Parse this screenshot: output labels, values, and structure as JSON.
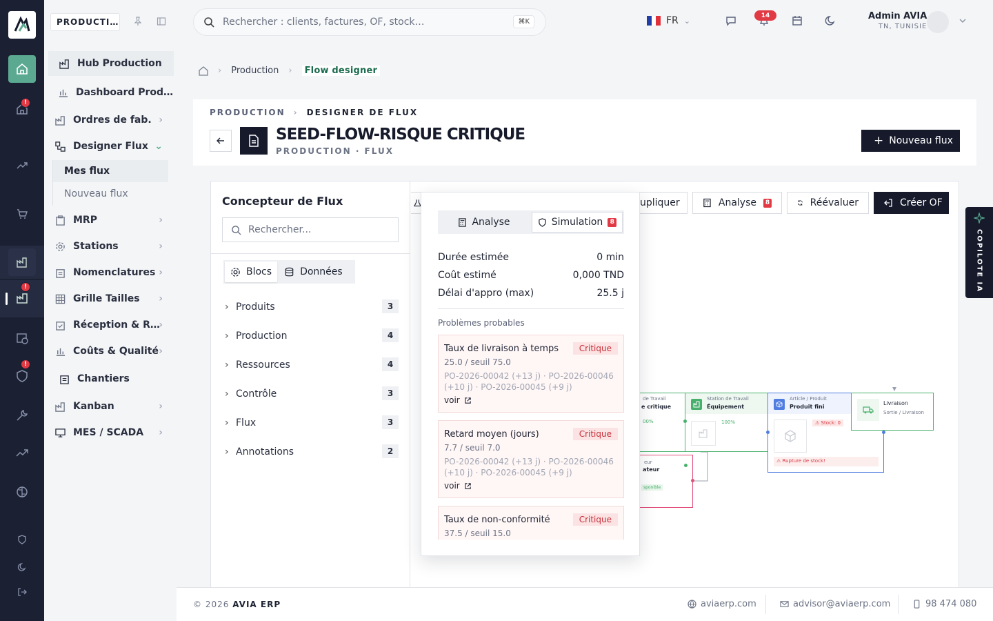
{
  "rail": {
    "badges": [
      "!",
      "!",
      "!"
    ]
  },
  "sidebar": {
    "module": "PRODUCTI…",
    "items": [
      {
        "label": "Hub Production"
      },
      {
        "label": "Dashboard Prod…"
      },
      {
        "label": "Ordres de fab."
      },
      {
        "label": "Designer Flux"
      },
      {
        "label": "MRP"
      },
      {
        "label": "Stations"
      },
      {
        "label": "Nomenclatures"
      },
      {
        "label": "Grille Tailles"
      },
      {
        "label": "Réception & R…"
      },
      {
        "label": "Coûts & Qualité"
      },
      {
        "label": "Chantiers"
      },
      {
        "label": "Kanban"
      },
      {
        "label": "MES / SCADA"
      }
    ],
    "sub": {
      "mes_flux": "Mes flux",
      "nouveau_flux": "Nouveau flux"
    }
  },
  "topbar": {
    "search_placeholder": "Rechercher : clients, factures, OF, stock…",
    "shortcut": "⌘K",
    "lang": "FR",
    "notif_count": "14",
    "user_name": "Admin AVIA",
    "user_country": "TN, TUNISIE"
  },
  "breadcrumb": {
    "production": "Production",
    "current": "Flow designer"
  },
  "header": {
    "eyebrow_section": "PRODUCTION",
    "eyebrow_page": "DESIGNER DE FLUX",
    "title": "SEED-FLOW-RISQUE CRITIQUE",
    "subtitle": "PRODUCTION · FLUX",
    "new_flow": "Nouveau flux"
  },
  "designer": {
    "panel_title": "Concepteur de Flux",
    "search_placeholder": "Rechercher...",
    "tab_blocs": "Blocs",
    "tab_donnees": "Données",
    "categories": [
      {
        "label": "Produits",
        "count": "3"
      },
      {
        "label": "Production",
        "count": "4"
      },
      {
        "label": "Ressources",
        "count": "4"
      },
      {
        "label": "Contrôle",
        "count": "3"
      },
      {
        "label": "Flux",
        "count": "3"
      },
      {
        "label": "Annotations",
        "count": "2"
      }
    ],
    "toolbar": {
      "dupliquer": "upliquer",
      "analyse": "Analyse",
      "analyse_count": "8",
      "reevaluer": "Réévaluer",
      "creer_of": "Créer OF"
    }
  },
  "nodes": {
    "n1_head": "de Travail",
    "n1_title": "e critique",
    "n1_pct": "00%",
    "n2_head": "Station de Travail",
    "n2_title": "Équipement",
    "n2_pct": "100%",
    "n3_head": "Article / Produit",
    "n3_title": "Produit fini",
    "n3_stock": "Stock: 0",
    "n3_alert": "Rupture de stock!",
    "n4_title": "Livraison",
    "n4_sub": "Sortie / Livraison",
    "n5_head": "eur",
    "n5_title": "ateur",
    "n5_tag": "sponible"
  },
  "copilot": "COPILOTE IA",
  "popup": {
    "tab_analyse": "Analyse",
    "tab_simulation": "Simulation",
    "sim_count": "8",
    "rows": [
      {
        "k": "Durée estimée",
        "v": "0 min"
      },
      {
        "k": "Coût estimé",
        "v": "0,000 TND"
      },
      {
        "k": "Délai d'appro (max)",
        "v": "25.5 j"
      }
    ],
    "problems_label": "Problèmes probables",
    "problems": [
      {
        "title": "Taux de livraison à temps",
        "level": "Critique",
        "metric": "25.0 / seuil 75.0",
        "refs": "PO-2026-00042 (+13 j) · PO-2026-00046 (+10 j) · PO-2026-00045 (+9 j)",
        "link": "voir"
      },
      {
        "title": "Retard moyen (jours)",
        "level": "Critique",
        "metric": "7.7 / seuil 7.0",
        "refs": "PO-2026-00042 (+13 j) · PO-2026-00046 (+10 j) · PO-2026-00045 (+9 j)",
        "link": "voir"
      },
      {
        "title": "Taux de non-conformité",
        "level": "Critique",
        "metric": "37.5 / seuil 15.0"
      }
    ]
  },
  "footer": {
    "copyright": "© 2026",
    "brand": "AVIA ERP",
    "site": "aviaerp.com",
    "email": "advisor@aviaerp.com",
    "phone": "98 474 080"
  },
  "colors": {
    "brand_dark": "#161a2b",
    "accent_green": "#5ba991",
    "critical": "#e23a44"
  }
}
